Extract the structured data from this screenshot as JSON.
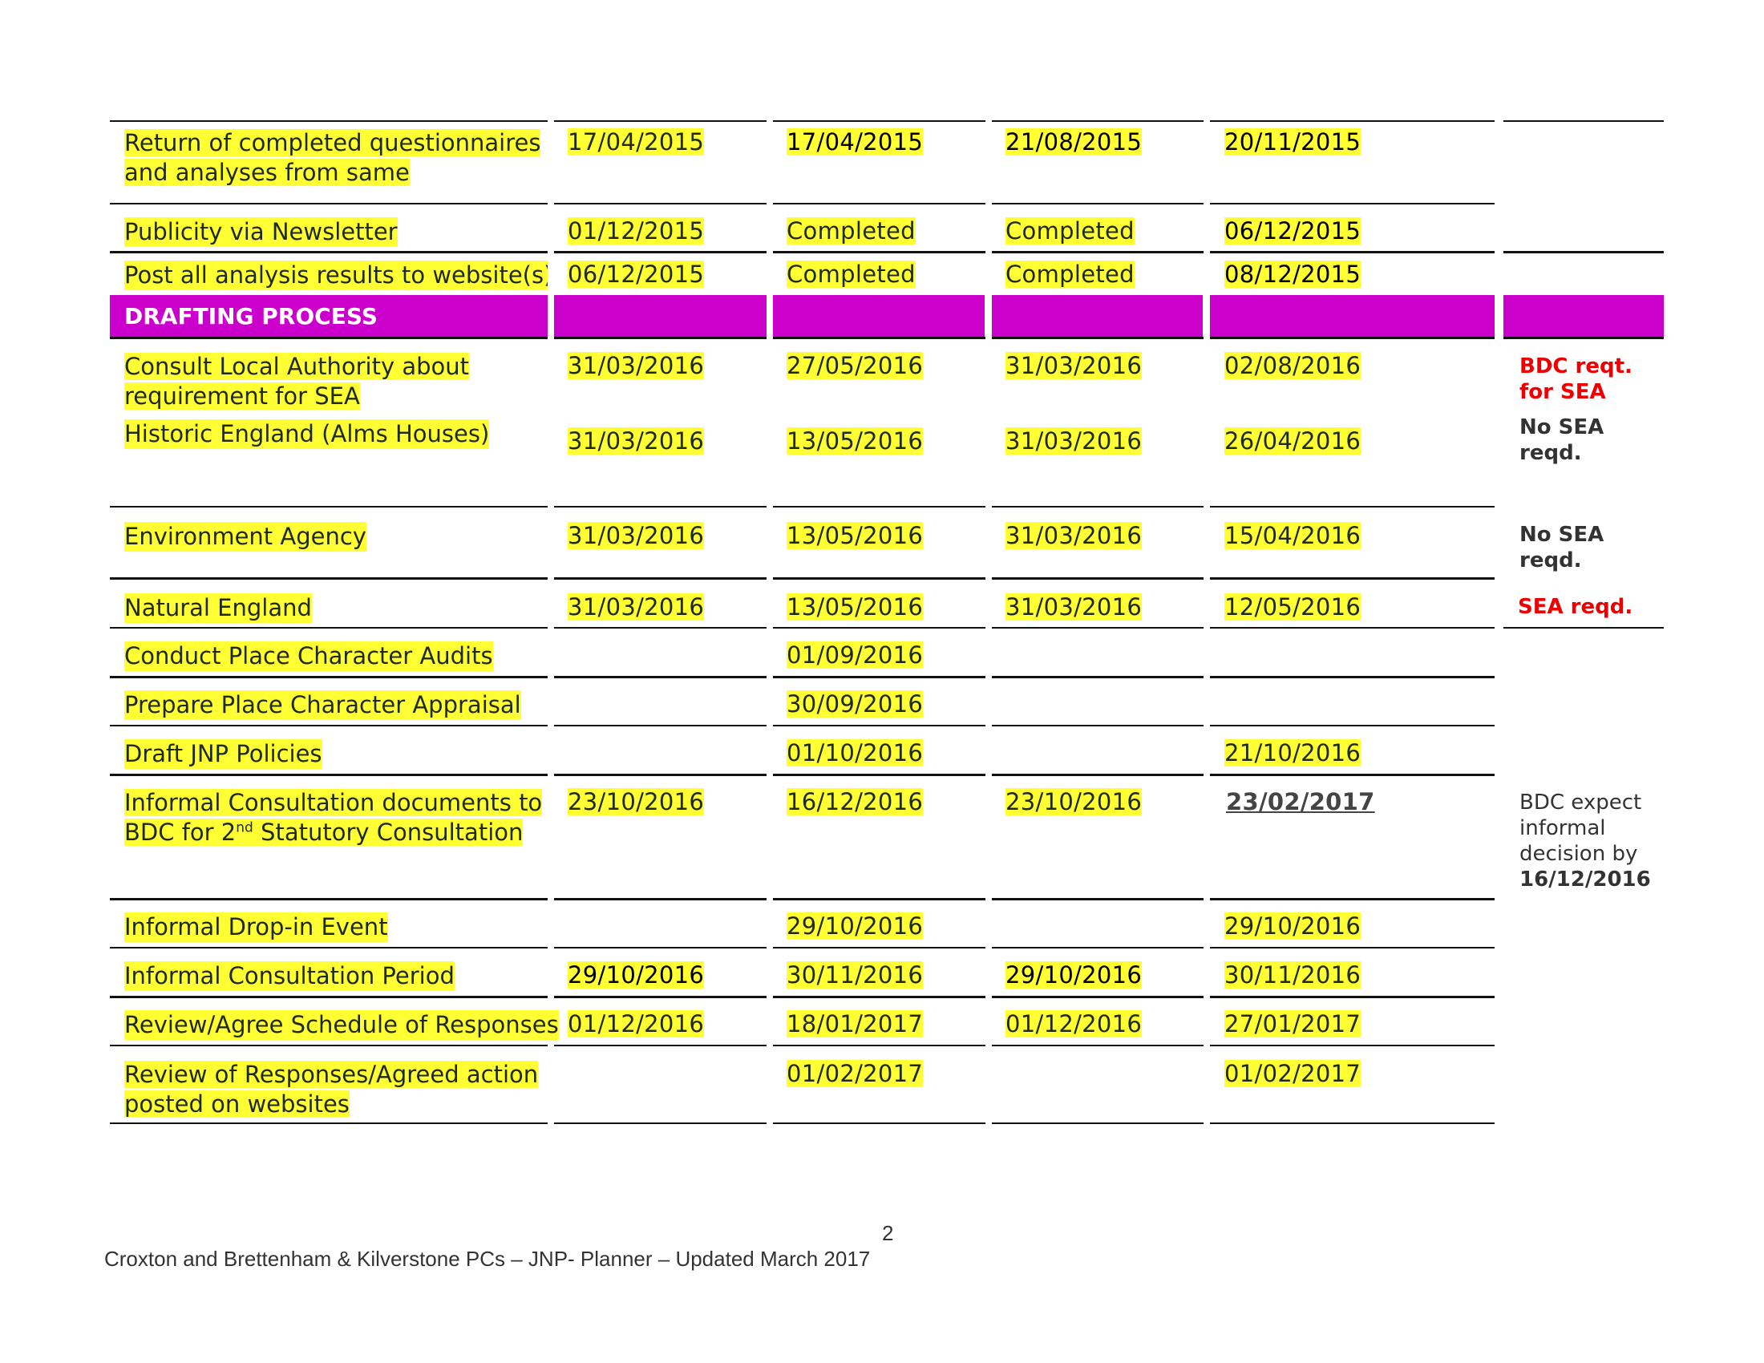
{
  "rows": {
    "r1": {
      "task": "Return of completed questionnaires",
      "task2": "and analyses from same",
      "c1": "17/04/2015",
      "c2": "17/04/2015",
      "c3": "21/08/2015",
      "c4": "20/11/2015"
    },
    "r2": {
      "task": "Publicity via Newsletter",
      "c1": "01/12/2015",
      "c2": "Completed",
      "c3": "Completed",
      "c4": "06/12/2015"
    },
    "r3": {
      "task": "Post all analysis results to website(s)",
      "c1": "06/12/2015",
      "c2": "Completed",
      "c3": "Completed",
      "c4": "08/12/2015"
    },
    "section": {
      "title": "DRAFTING PROCESS"
    },
    "r4": {
      "task": "Consult Local Authority about",
      "task2": "requirement for SEA",
      "c1": "31/03/2016",
      "c2": "27/05/2016",
      "c3": "31/03/2016",
      "c4": "02/08/2016",
      "note1": "BDC reqt.",
      "note2": "for SEA"
    },
    "r5": {
      "task": "Historic England (Alms Houses)",
      "c1": "31/03/2016",
      "c2": "13/05/2016",
      "c3": "31/03/2016",
      "c4": "26/04/2016",
      "note1": "No SEA",
      "note2": "reqd."
    },
    "r6": {
      "task": "Environment Agency",
      "c1": "31/03/2016",
      "c2": "13/05/2016",
      "c3": "31/03/2016",
      "c4": "15/04/2016",
      "note1": "No SEA",
      "note2": "reqd."
    },
    "r7": {
      "task": "Natural England",
      "c1": "31/03/2016",
      "c2": "13/05/2016",
      "c3": "31/03/2016",
      "c4": "12/05/2016",
      "note1": "SEA reqd."
    },
    "r8": {
      "task": "Conduct Place Character Audits",
      "c2": "01/09/2016"
    },
    "r9": {
      "task": "Prepare Place Character Appraisal",
      "c2": "30/09/2016"
    },
    "r10": {
      "task": "Draft JNP Policies",
      "c2": "01/10/2016",
      "c4": "21/10/2016"
    },
    "r11": {
      "task": "Informal Consultation documents to",
      "task2a": "BDC for 2",
      "task2sup": "nd",
      "task2b": " Statutory Consultation",
      "c1": "23/10/2016",
      "c2": "16/12/2016",
      "c3": "23/10/2016",
      "c4": "23/02/2017",
      "note1": "BDC expect",
      "note2": "informal",
      "note3": "decision by",
      "note4": "16/12/2016"
    },
    "r12": {
      "task": "Informal Drop-in Event",
      "c2": "29/10/2016",
      "c4": "29/10/2016"
    },
    "r13": {
      "task": "Informal Consultation Period",
      "c1": "29/10/2016",
      "c2": "30/11/2016",
      "c3": "29/10/2016",
      "c4": "30/11/2016"
    },
    "r14": {
      "task": "Review/Agree Schedule of Responses",
      "c1": "01/12/2016",
      "c2": "18/01/2017",
      "c3": "01/12/2016",
      "c4": "27/01/2017"
    },
    "r15": {
      "task": "Review of Responses/Agreed action",
      "task2": "posted on websites",
      "c2": "01/02/2017",
      "c4": "01/02/2017"
    }
  },
  "footer": {
    "page_number": "2",
    "text": "Croxton and Brettenham & Kilverstone PCs – JNP- Planner – Updated March 2017"
  },
  "colors": {
    "highlight": "#ffff33",
    "section_band": "#cc00cc",
    "note_red": "#ee0000"
  }
}
